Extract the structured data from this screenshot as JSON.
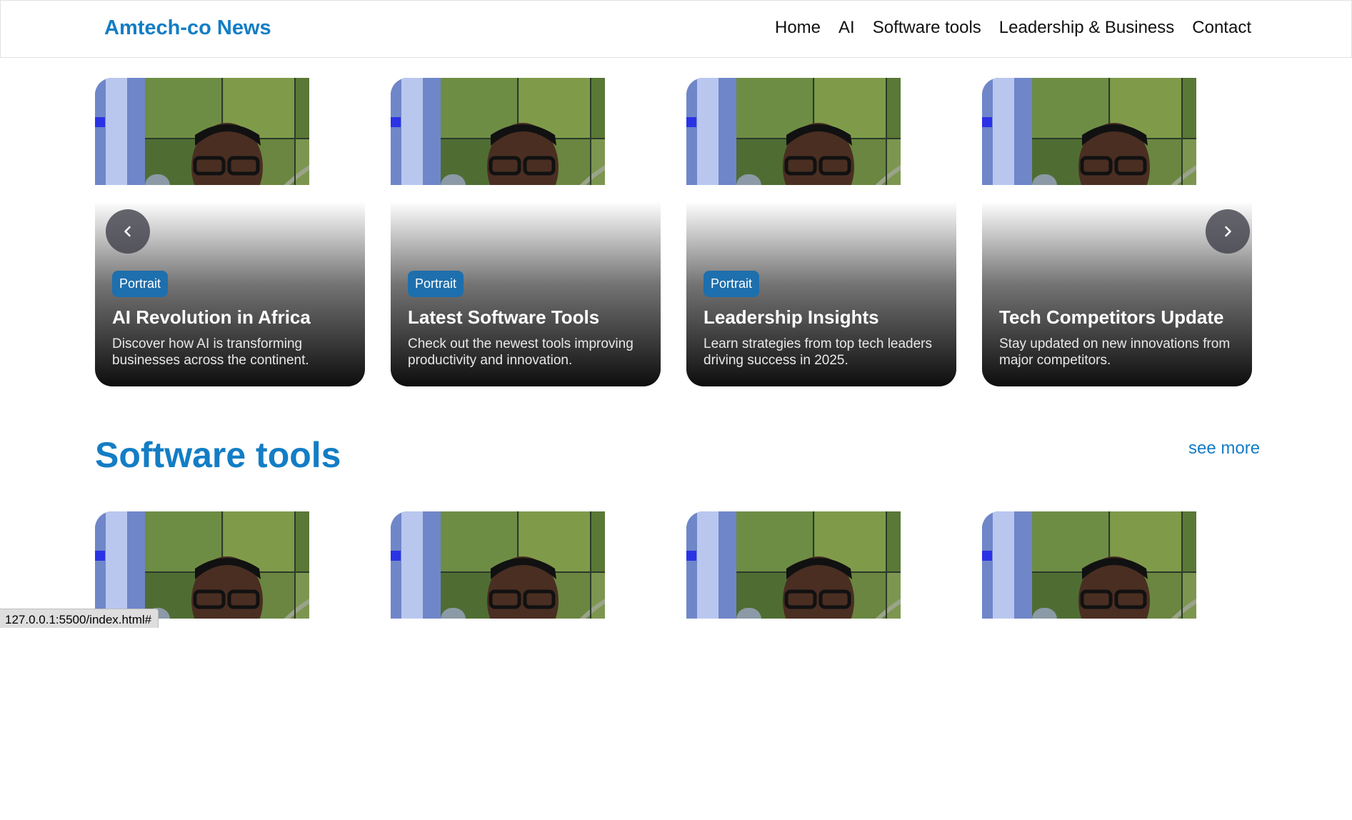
{
  "header": {
    "brand": "Amtech-co News",
    "nav": [
      "Home",
      "AI",
      "Software tools",
      "Leadership & Business",
      "Contact"
    ]
  },
  "carousel": {
    "cards": [
      {
        "badge": "Portrait",
        "title": "AI Revolution in Africa",
        "desc": "Discover how AI is transforming businesses across the continent."
      },
      {
        "badge": "Portrait",
        "title": "Latest Software Tools",
        "desc": "Check out the newest tools improving productivity and innovation."
      },
      {
        "badge": "Portrait",
        "title": "Leadership Insights",
        "desc": "Learn strategies from top tech leaders driving success in 2025."
      },
      {
        "badge": "",
        "title": "Tech Competitors Update",
        "desc": "Stay updated on new innovations from major competitors."
      }
    ],
    "prev_icon": "chevron-left-icon",
    "next_icon": "chevron-right-icon"
  },
  "section": {
    "title": "Software tools",
    "see_more": "see more"
  },
  "status_url": "127.0.0.1:5500/index.html#",
  "colors": {
    "brand": "#137dc5",
    "badge": "#1e6fad"
  }
}
